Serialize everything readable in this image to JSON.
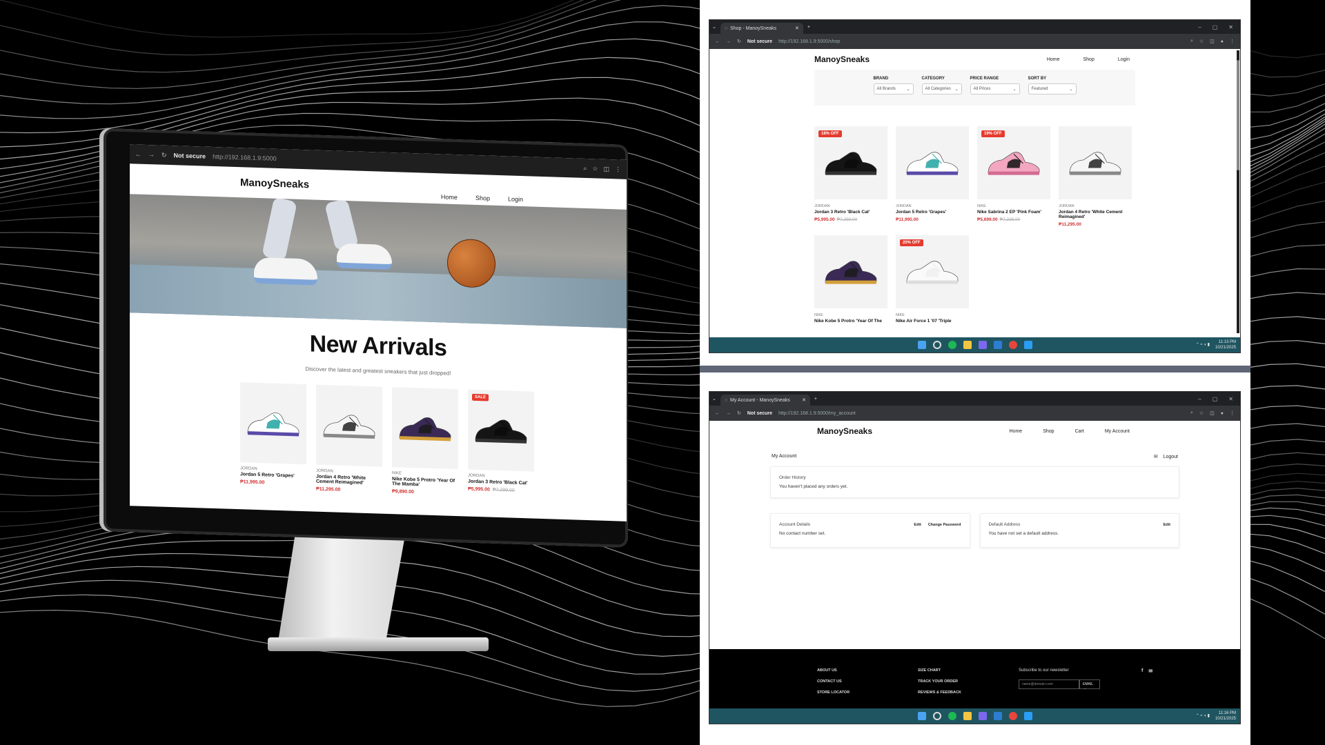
{
  "colors": {
    "sale_red": "#e53b2e",
    "price_red": "#d03030",
    "taskbar": "#1f5561",
    "chrome_dark": "#202124"
  },
  "monitor": {
    "security": "Not secure",
    "url": "http://192.168.1.9:5000",
    "logo": "ManoySneaks",
    "nav": [
      "Home",
      "Shop",
      "Login"
    ],
    "heading": "New Arrivals",
    "subheading": "Discover the latest and greatest sneakers that just dropped!",
    "products": [
      {
        "brand": "JORDAN",
        "name": "Jordan 5 Retro 'Grapes'",
        "price": "₱11,995.00",
        "old": "",
        "badge": "",
        "colors": [
          "#ffffff",
          "#5a4aa8",
          "#1fa3a0"
        ]
      },
      {
        "brand": "JORDAN",
        "name": "Jordan 4 Retro 'White Cement Reimagined'",
        "price": "₱11,295.00",
        "old": "",
        "badge": "",
        "colors": [
          "#f5f5f5",
          "#888888",
          "#222222"
        ]
      },
      {
        "brand": "NIKE",
        "name": "Nike Kobe 5 Protro 'Year Of The Mamba'",
        "price": "₱9,890.00",
        "old": "",
        "badge": "",
        "colors": [
          "#3a2a55",
          "#d4a03a",
          "#1b1b1b"
        ]
      },
      {
        "brand": "JORDAN",
        "name": "Jordan 3 Retro 'Black Cat'",
        "price": "₱5,995.00",
        "old": "₱7,299.00",
        "badge": "SALE",
        "colors": [
          "#151515",
          "#333333",
          "#0a0a0a"
        ]
      }
    ]
  },
  "shop_window": {
    "tab_title": "Shop - ManoySneaks",
    "security": "Not secure",
    "url": "http://192.168.1.9:5000/shop",
    "logo": "ManoySneaks",
    "nav": [
      "Home",
      "Shop",
      "Login"
    ],
    "filters": [
      {
        "label": "BRAND",
        "value": "All Brands"
      },
      {
        "label": "CATEGORY",
        "value": "All Categories"
      },
      {
        "label": "PRICE RANGE",
        "value": "All Prices"
      },
      {
        "label": "SORT BY",
        "value": "Featured"
      }
    ],
    "products": [
      {
        "brand": "JORDAN",
        "name": "Jordan 3 Retro 'Black Cat'",
        "price": "₱5,995.00",
        "old": "₱7,299.00",
        "badge": "18% OFF",
        "colors": [
          "#151515",
          "#333333",
          "#0a0a0a"
        ]
      },
      {
        "brand": "JORDAN",
        "name": "Jordan 5 Retro 'Grapes'",
        "price": "₱11,995.00",
        "old": "",
        "badge": "",
        "colors": [
          "#ffffff",
          "#5a4aa8",
          "#1fa3a0"
        ]
      },
      {
        "brand": "NIKE",
        "name": "Nike Sabrina 2 EP 'Pink Foam'",
        "price": "₱5,699.00",
        "old": "₱7,235.00",
        "badge": "19% OFF",
        "colors": [
          "#f2a6c0",
          "#d46b92",
          "#111111"
        ]
      },
      {
        "brand": "JORDAN",
        "name": "Jordan 4 Retro 'White Cement Reimagined'",
        "price": "₱11,295.00",
        "old": "",
        "badge": "",
        "colors": [
          "#f5f5f5",
          "#888888",
          "#222222"
        ]
      },
      {
        "brand": "NIKE",
        "name": "Nike Kobe 5 Protro 'Year Of The",
        "price": "",
        "old": "",
        "badge": "",
        "colors": [
          "#3a2a55",
          "#d4a03a",
          "#1b1b1b"
        ]
      },
      {
        "brand": "NIKE",
        "name": "Nike Air Force 1 '07 'Triple",
        "price": "",
        "old": "",
        "badge": "20% OFF",
        "colors": [
          "#fafafa",
          "#dddddd",
          "#eeeeee"
        ]
      }
    ],
    "clock": {
      "time": "11:13 PM",
      "date": "10/21/2025"
    }
  },
  "account_window": {
    "tab_title": "My Account - ManoySneaks",
    "security": "Not secure",
    "url": "http://192.168.1.9:5000/my_account",
    "logo": "ManoySneaks",
    "nav": [
      "Home",
      "Shop",
      "Cart",
      "My Account"
    ],
    "page_title": "My Account",
    "logout": "Logout",
    "order_history": {
      "title": "Order History",
      "text": "You haven't placed any orders yet."
    },
    "account_details": {
      "title": "Account Details",
      "edit": "Edit",
      "change_password": "Change Password",
      "text": "No contact number set."
    },
    "default_address": {
      "title": "Default Address",
      "edit": "Edit",
      "text": "You have not set a default address."
    },
    "footer": {
      "col1": [
        "ABOUT US",
        "CONTACT US",
        "STORE LOCATOR"
      ],
      "col2": [
        "SIZE CHART",
        "TRACK YOUR ORDER",
        "REVIEWS & FEEDBACK"
      ],
      "newsletter": "Subscribe to our newsletter",
      "email_placeholder": "name@domain.com",
      "email_button": "EMAIL →"
    },
    "clock": {
      "time": "11:16 PM",
      "date": "10/21/2025"
    }
  }
}
